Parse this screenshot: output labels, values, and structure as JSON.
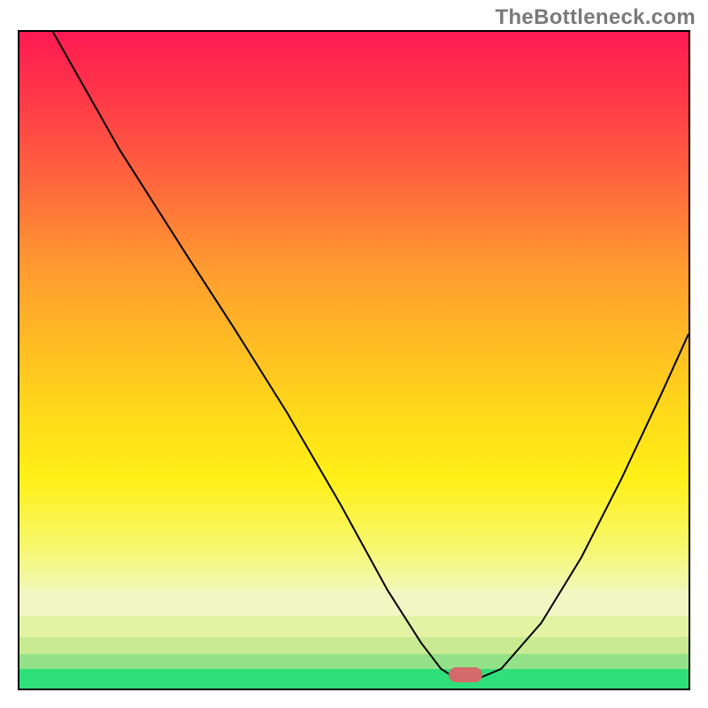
{
  "watermark_text": "TheBottleneck.com",
  "chart_data": {
    "type": "line",
    "title": "",
    "xlabel": "",
    "ylabel": "",
    "xlim": [
      0,
      100
    ],
    "ylim": [
      0,
      100
    ],
    "legend": false,
    "grid": false,
    "background": {
      "description": "vertical rainbow gradient red→orange→yellow→pale-yellow→green",
      "bands_lower": [
        {
          "top_pct": 85.0,
          "height_pct": 4.0,
          "color": "#f1f6c3"
        },
        {
          "top_pct": 89.0,
          "height_pct": 3.2,
          "color": "#e4f2a4"
        },
        {
          "top_pct": 92.2,
          "height_pct": 2.6,
          "color": "#c9ea90"
        },
        {
          "top_pct": 94.8,
          "height_pct": 2.2,
          "color": "#93e289"
        },
        {
          "top_pct": 97.0,
          "height_pct": 3.0,
          "color": "#2fe07a"
        }
      ]
    },
    "curve": {
      "description": "V-shaped bottleneck curve",
      "points_pct": [
        [
          5.0,
          0.0
        ],
        [
          15.0,
          18.0
        ],
        [
          25.0,
          34.0
        ],
        [
          32.0,
          45.0
        ],
        [
          40.0,
          58.0
        ],
        [
          48.0,
          72.0
        ],
        [
          55.0,
          85.0
        ],
        [
          60.0,
          93.0
        ],
        [
          63.0,
          97.0
        ],
        [
          65.0,
          98.3
        ],
        [
          69.0,
          98.3
        ],
        [
          72.0,
          97.0
        ],
        [
          78.0,
          90.0
        ],
        [
          84.0,
          80.0
        ],
        [
          90.0,
          68.0
        ],
        [
          96.0,
          55.0
        ],
        [
          100.0,
          46.0
        ]
      ],
      "stroke": "#000000",
      "stroke_width": 2
    },
    "marker": {
      "description": "optimal point pill indicator",
      "left_pct": 64.2,
      "top_pct": 96.8,
      "width_pct": 5.0,
      "height_pct": 2.2,
      "color": "#d46a6a"
    }
  }
}
